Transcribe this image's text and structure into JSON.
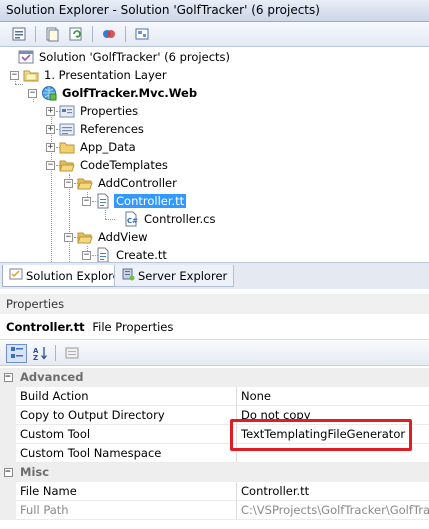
{
  "window": {
    "title": "Solution Explorer - Solution 'GolfTracker' (6 projects)"
  },
  "toolbar": {
    "buttons": [
      "properties-icon",
      "show-all-files-icon",
      "refresh-icon",
      "view-class-diagram-icon",
      "view-designer-icon"
    ]
  },
  "tree": {
    "solution": "Solution 'GolfTracker' (6 projects)",
    "presentation_layer": "1. Presentation Layer",
    "project": "GolfTracker.Mvc.Web",
    "properties": "Properties",
    "references": "References",
    "app_data": "App_Data",
    "code_templates": "CodeTemplates",
    "add_controller": "AddController",
    "controller_tt": "Controller.tt",
    "controller_cs": "Controller.cs",
    "add_view": "AddView",
    "create_tt": "Create.tt"
  },
  "tabs": {
    "solution_explorer": "Solution Explorer",
    "server_explorer": "Server Explorer"
  },
  "properties": {
    "header": "Properties",
    "object_name": "Controller.tt",
    "object_type": "File Properties",
    "categories": [
      {
        "name": "Advanced",
        "rows": [
          {
            "name": "Build Action",
            "value": "None"
          },
          {
            "name": "Copy to Output Directory",
            "value": "Do not copy"
          },
          {
            "name": "Custom Tool",
            "value": "TextTemplatingFileGenerator"
          },
          {
            "name": "Custom Tool Namespace",
            "value": ""
          }
        ]
      },
      {
        "name": "Misc",
        "rows": [
          {
            "name": "File Name",
            "value": "Controller.tt"
          },
          {
            "name": "Full Path",
            "value": "C:\\VSProjects\\GolfTracker\\GolfTrack"
          }
        ]
      }
    ]
  },
  "colors": {
    "selection": "#3399ff",
    "annotation": "#e01c24",
    "folder": "#e8c15a"
  }
}
